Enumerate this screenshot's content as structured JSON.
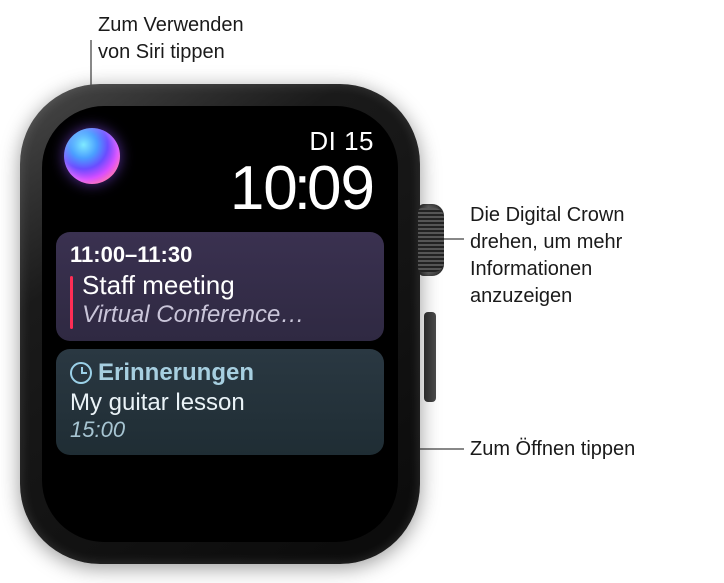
{
  "callouts": {
    "siri": "Zum Verwenden\nvon Siri tippen",
    "crown": "Die Digital Crown\ndrehen, um mehr\nInformationen\nanzuzeigen",
    "open": "Zum Öffnen tippen"
  },
  "datetime": {
    "date": "DI 15",
    "time_h": "10",
    "time_m": "09"
  },
  "calendar": {
    "time_range": "11:00–11:30",
    "title": "Staff meeting",
    "location": "Virtual Conference…"
  },
  "reminders": {
    "header": "Erinnerungen",
    "text": "My guitar lesson",
    "time": "15:00"
  },
  "icons": {
    "siri": "siri-orb",
    "clock": "clock-icon"
  }
}
